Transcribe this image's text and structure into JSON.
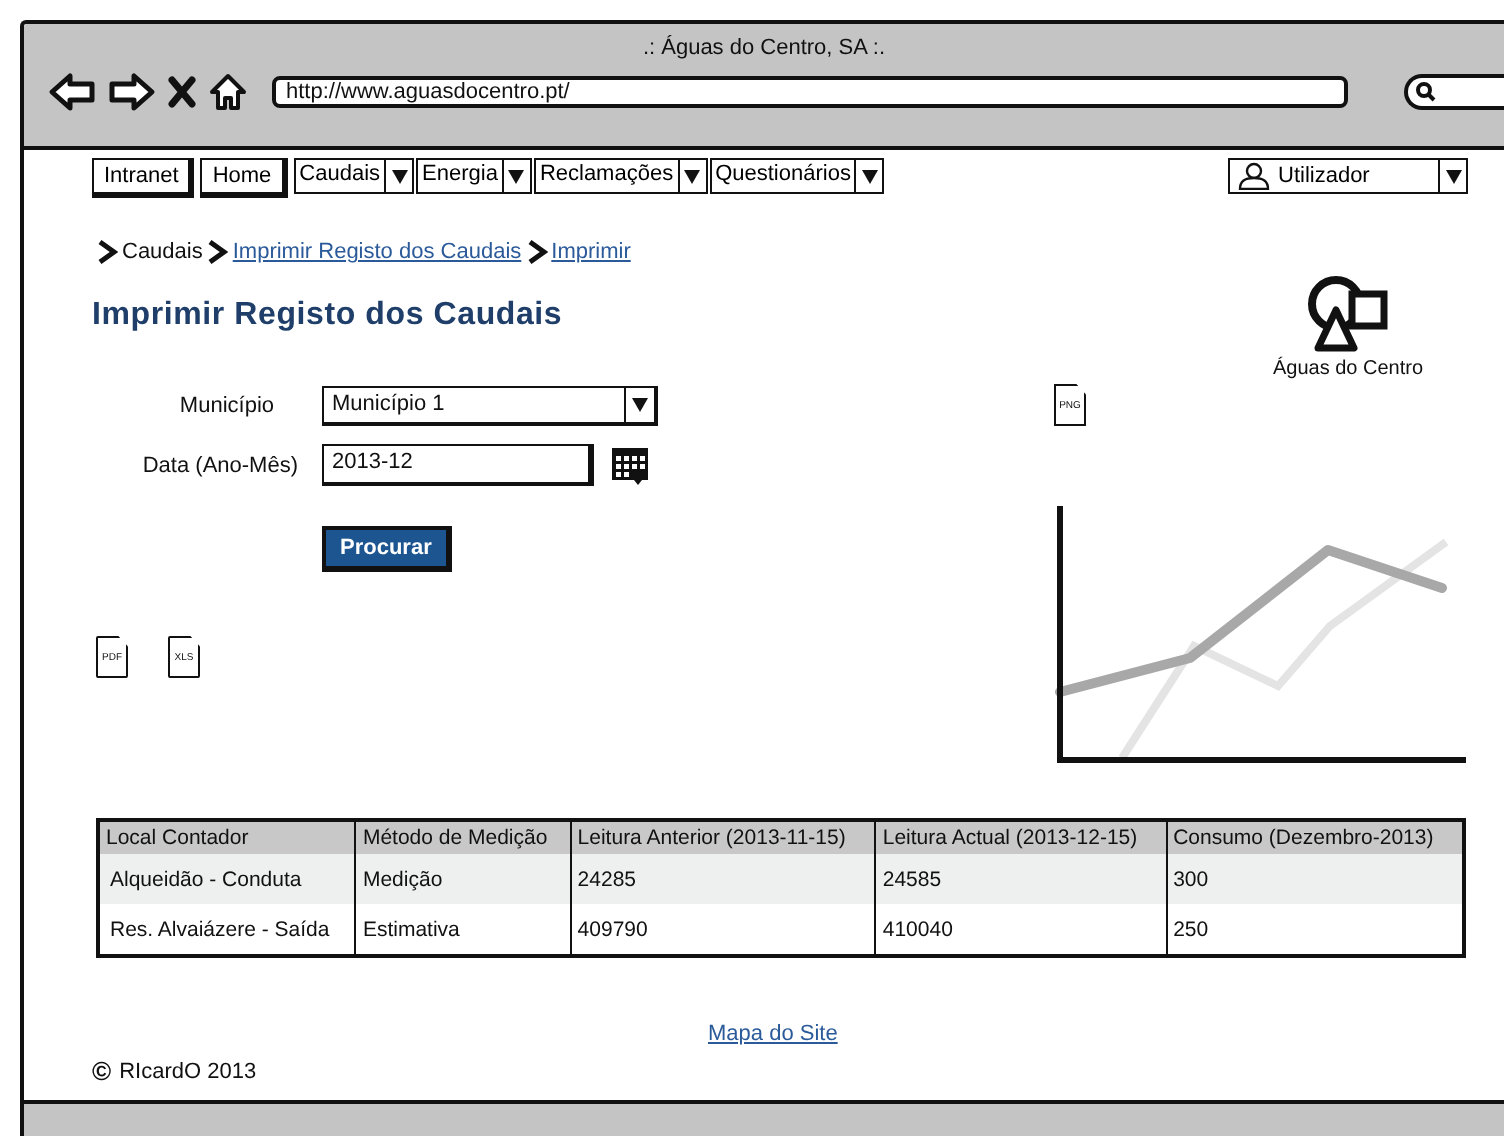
{
  "window": {
    "title": ".: Águas do Centro, SA :."
  },
  "browser": {
    "url": "http://www.aguasdocentro.pt/"
  },
  "nav": {
    "items": [
      {
        "label": "Intranet",
        "kind": "button"
      },
      {
        "label": "Home",
        "kind": "button"
      },
      {
        "label": "Caudais",
        "kind": "dropdown"
      },
      {
        "label": "Energia",
        "kind": "dropdown"
      },
      {
        "label": "Reclamações",
        "kind": "dropdown"
      },
      {
        "label": "Questionários",
        "kind": "dropdown"
      }
    ],
    "user": {
      "label": "Utilizador"
    }
  },
  "breadcrumb": [
    {
      "label": "Caudais",
      "kind": "text"
    },
    {
      "label": "Imprimir Registo dos Caudais",
      "kind": "link"
    },
    {
      "label": "Imprimir",
      "kind": "link"
    }
  ],
  "heading": "Imprimir Registo dos Caudais",
  "logo": {
    "caption": "Águas do Centro"
  },
  "form": {
    "fields": [
      {
        "label": "Município",
        "kind": "select",
        "value": "Município 1"
      },
      {
        "label": "Data (Ano-Mês)",
        "kind": "date",
        "value": "2013-12"
      }
    ],
    "submit": "Procurar"
  },
  "exports": [
    {
      "label": "PDF"
    },
    {
      "label": "XLS"
    }
  ],
  "chart_export": {
    "label": "PNG"
  },
  "table": {
    "columns": [
      "Local Contador",
      "Método de Medição",
      "Leitura Anterior (2013-11-15)",
      "Leitura Actual (2013-12-15)",
      "Consumo (Dezembro-2013)"
    ],
    "rows": [
      [
        "Alqueidão - Conduta",
        "Medição",
        "24285",
        "24585",
        "300"
      ],
      [
        "Res. Alvaiázere - Saída",
        "Estimativa",
        "409790",
        "410040",
        "250"
      ]
    ]
  },
  "footer": {
    "link": "Mapa do Site",
    "copyright_mark": "©",
    "copyright": "RIcardO 2013"
  }
}
